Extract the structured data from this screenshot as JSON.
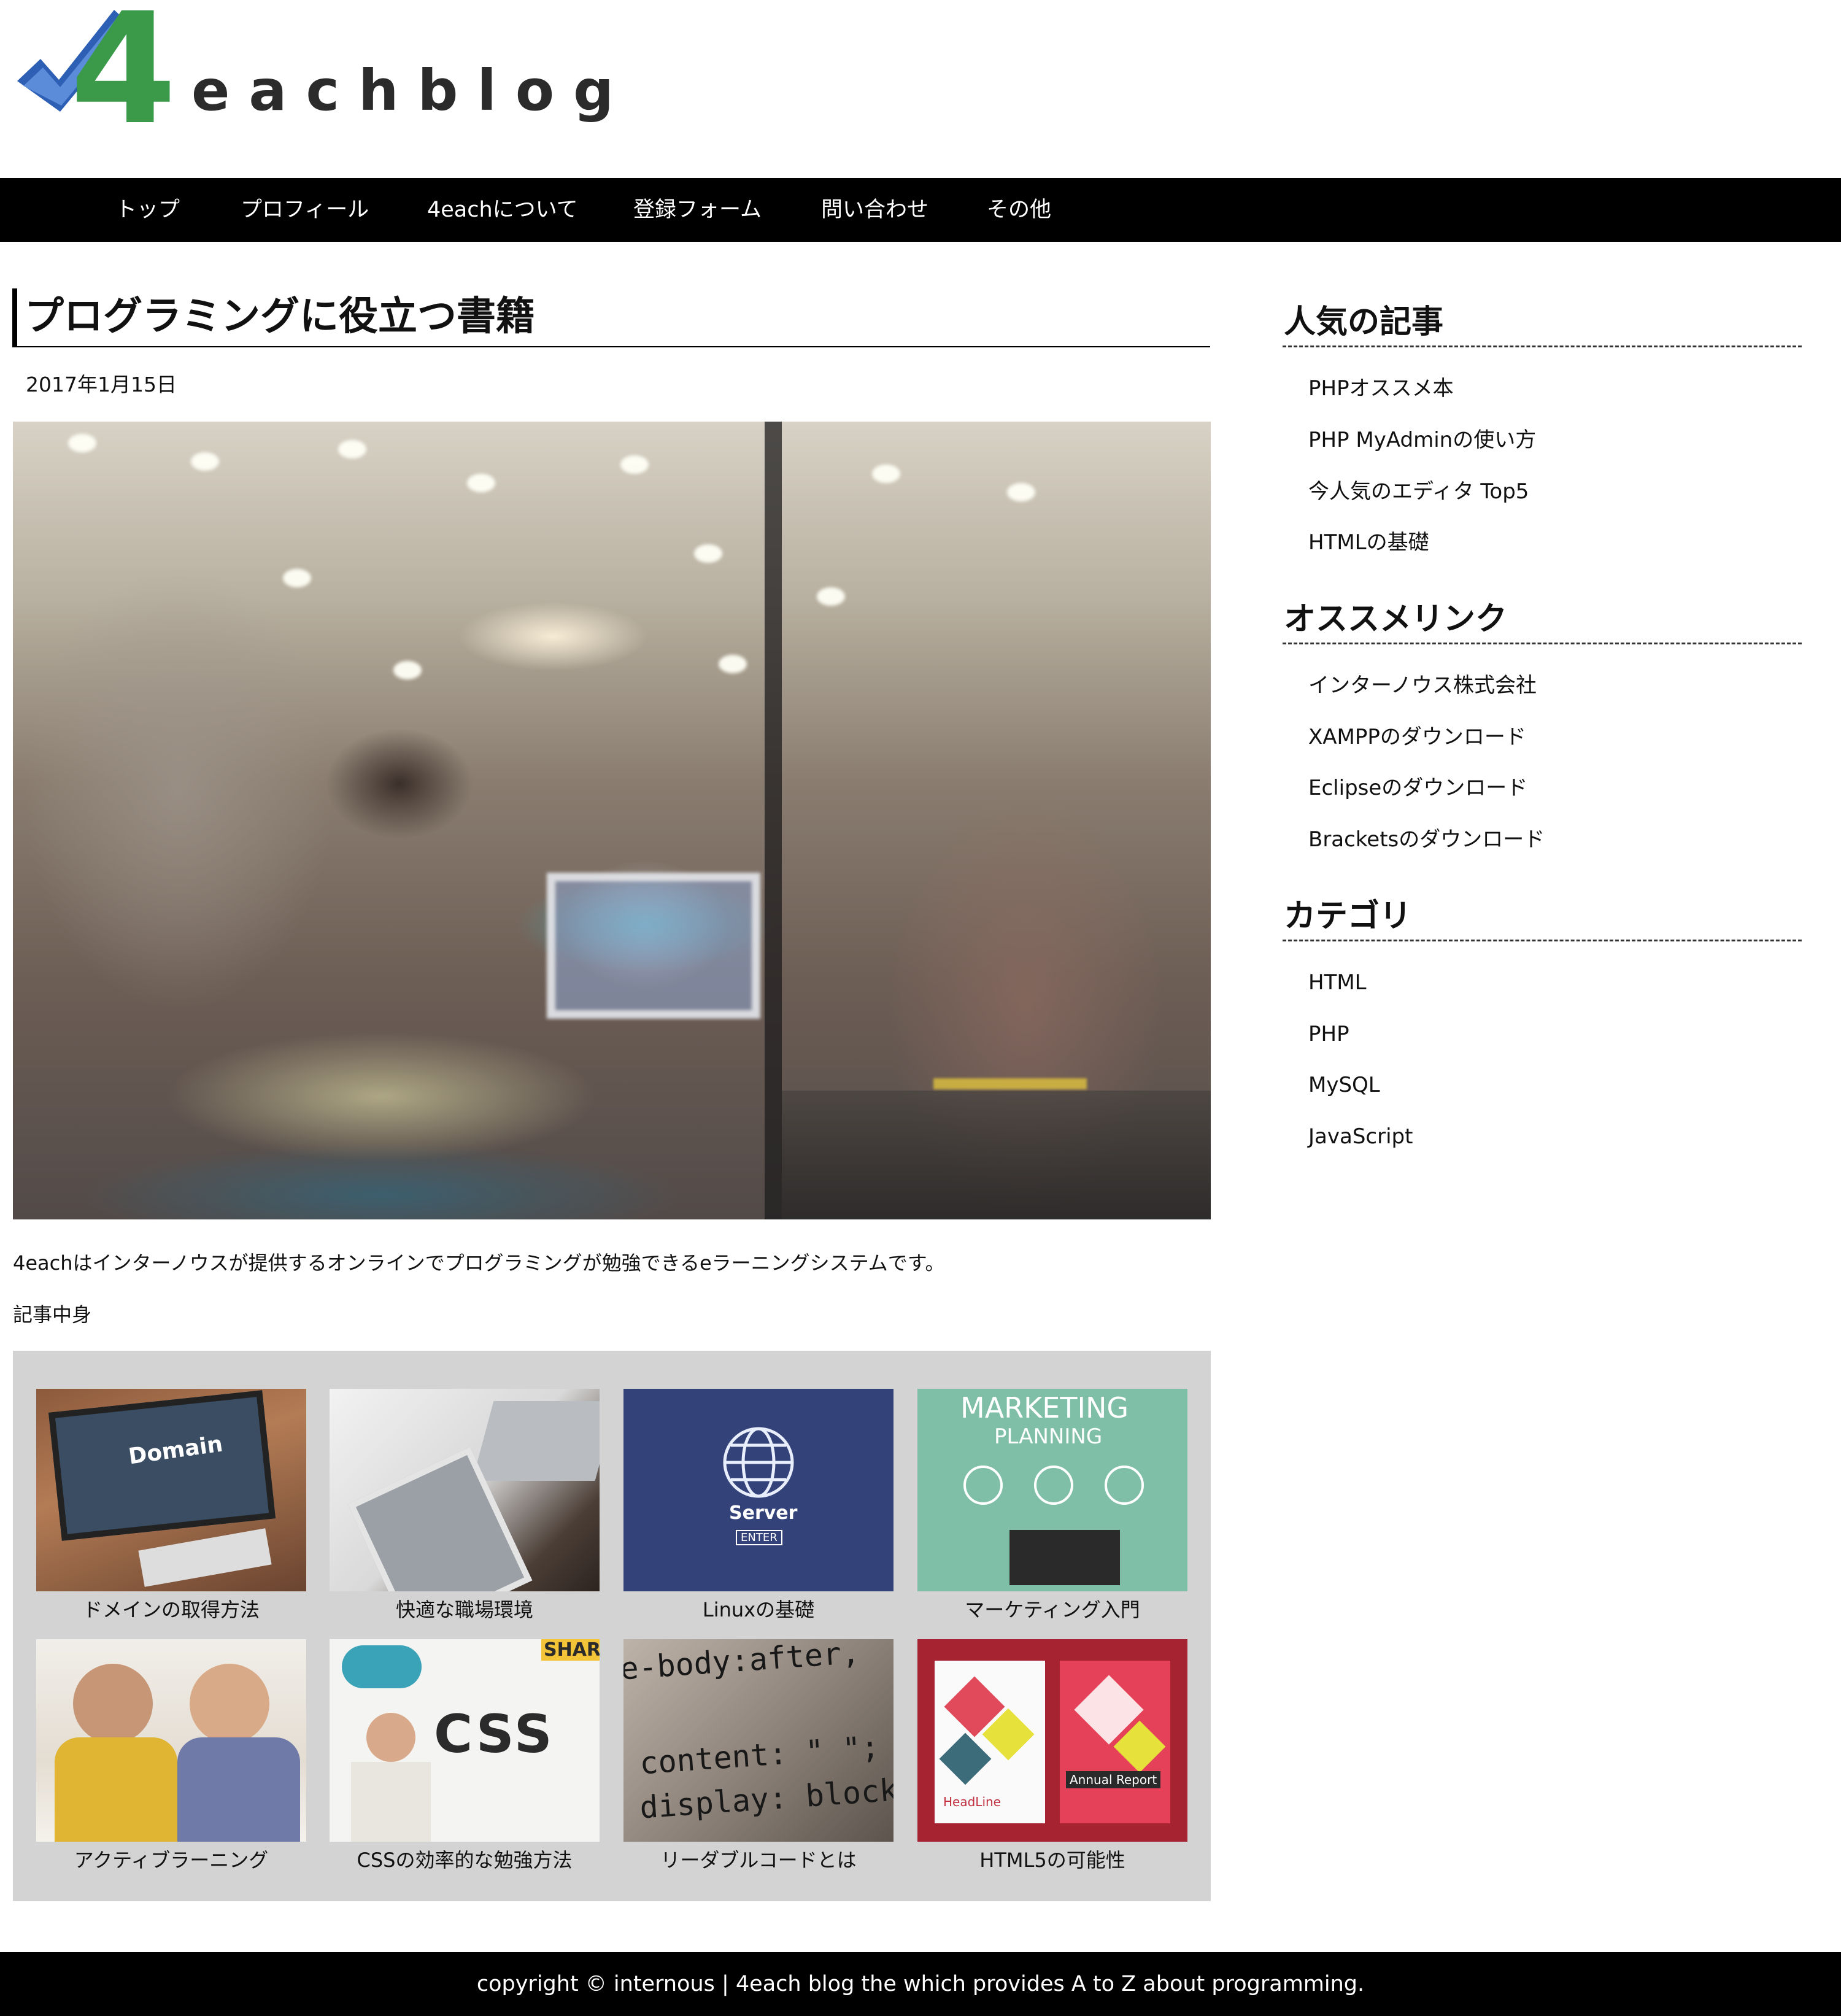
{
  "header": {
    "logo_text": "eachblog",
    "logo_mark_text": "4"
  },
  "nav": [
    "トップ",
    "プロフィール",
    "4eachについて",
    "登録フォーム",
    "問い合わせ",
    "その他"
  ],
  "post": {
    "title": "プログラミングに役立つ書籍",
    "date": "2017年1月15日",
    "intro": "4eachはインターノウスが提供するオンラインでプログラミングが勉強できるeラーニングシステムです。",
    "body": "記事中身"
  },
  "cards": [
    {
      "caption": "ドメインの取得方法",
      "image_text": "Domain"
    },
    {
      "caption": "快適な職場環境",
      "image_text": ""
    },
    {
      "caption": "Linuxの基礎",
      "image_text": "Server",
      "image_text_2": "ENTER"
    },
    {
      "caption": "マーケティング入門",
      "image_text": "MARKETING",
      "image_text_2": "PLANNING"
    },
    {
      "caption": "アクティブラーニング",
      "image_text": ""
    },
    {
      "caption": "CSSの効率的な勉強方法",
      "image_text": "CSS",
      "image_text_2": "SHARE"
    },
    {
      "caption": "リーダブルコードとは",
      "image_text": "e-body:after,",
      "image_text_2": "content: \" \";",
      "image_text_3": "display: block;"
    },
    {
      "caption": "HTML5の可能性",
      "image_text": "HeadLine",
      "image_text_2": "Annual Report"
    }
  ],
  "sidebar": {
    "popular": {
      "heading": "人気の記事",
      "links": [
        "PHPオススメ本",
        "PHP MyAdminの使い方",
        "今人気のエディタ Top5",
        "HTMLの基礎"
      ]
    },
    "recommended": {
      "heading": "オススメリンク",
      "links": [
        "インターノウス株式会社",
        "XAMPPのダウンロード",
        "Eclipseのダウンロード",
        "Bracketsのダウンロード"
      ]
    },
    "category": {
      "heading": "カテゴリ",
      "links": [
        "HTML",
        "PHP",
        "MySQL",
        "JavaScript"
      ]
    }
  },
  "footer": {
    "text": "copyright © internous | 4each blog the which provides A to Z about programming."
  }
}
